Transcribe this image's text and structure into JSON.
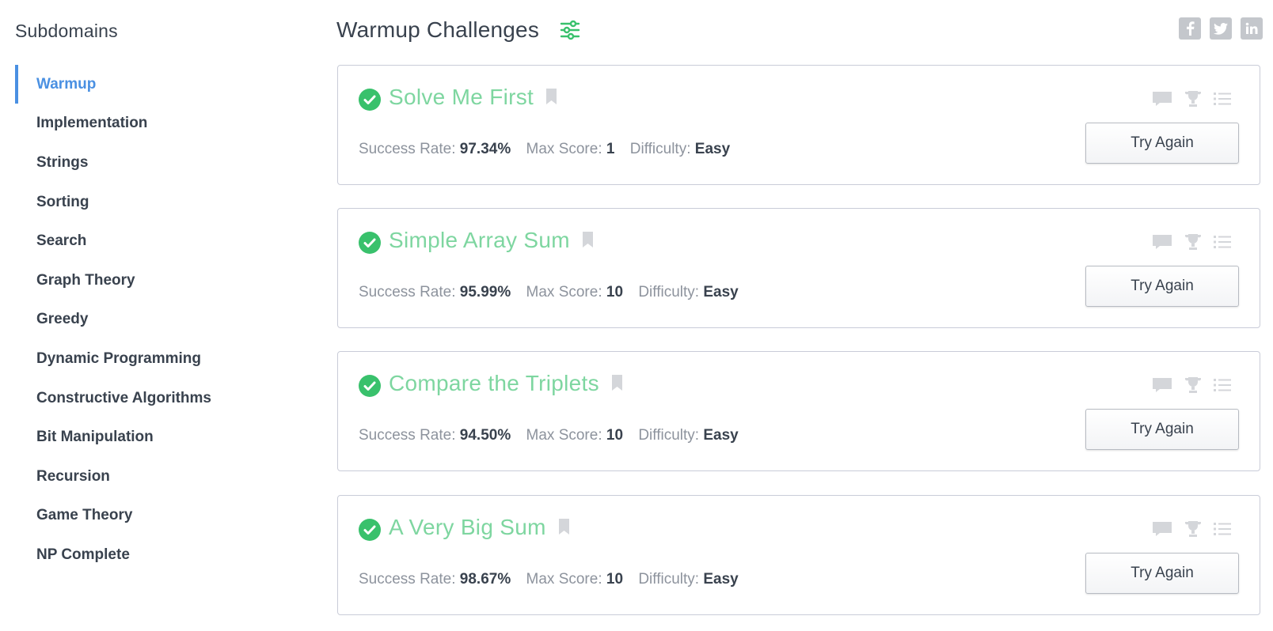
{
  "sidebar": {
    "title": "Subdomains",
    "items": [
      {
        "label": "Warmup",
        "active": true
      },
      {
        "label": "Implementation"
      },
      {
        "label": "Strings"
      },
      {
        "label": "Sorting"
      },
      {
        "label": "Search"
      },
      {
        "label": "Graph Theory"
      },
      {
        "label": "Greedy"
      },
      {
        "label": "Dynamic Programming"
      },
      {
        "label": "Constructive Algorithms"
      },
      {
        "label": "Bit Manipulation"
      },
      {
        "label": "Recursion"
      },
      {
        "label": "Game Theory"
      },
      {
        "label": "NP Complete"
      }
    ]
  },
  "header": {
    "title": "Warmup Challenges",
    "filter_icon": "sliders-icon",
    "social": [
      "facebook-icon",
      "twitter-icon",
      "linkedin-icon"
    ]
  },
  "labels": {
    "success_rate": "Success Rate:",
    "max_score": "Max Score:",
    "difficulty": "Difficulty:"
  },
  "challenges": [
    {
      "title": "Solve Me First",
      "success_rate": "97.34%",
      "max_score": "1",
      "difficulty": "Easy",
      "action": "Try Again",
      "solved": true
    },
    {
      "title": "Simple Array Sum",
      "success_rate": "95.99%",
      "max_score": "10",
      "difficulty": "Easy",
      "action": "Try Again",
      "solved": true
    },
    {
      "title": "Compare the Triplets",
      "success_rate": "94.50%",
      "max_score": "10",
      "difficulty": "Easy",
      "action": "Try Again",
      "solved": true
    },
    {
      "title": "A Very Big Sum",
      "success_rate": "98.67%",
      "max_score": "10",
      "difficulty": "Easy",
      "action": "Try Again",
      "solved": true
    }
  ],
  "colors": {
    "accent": "#4a90e2",
    "solved_green": "#39c16c",
    "title_green": "#7ed6a0",
    "text": "#39424e",
    "muted": "#8d939d",
    "icon_gray": "#d4d6da"
  }
}
